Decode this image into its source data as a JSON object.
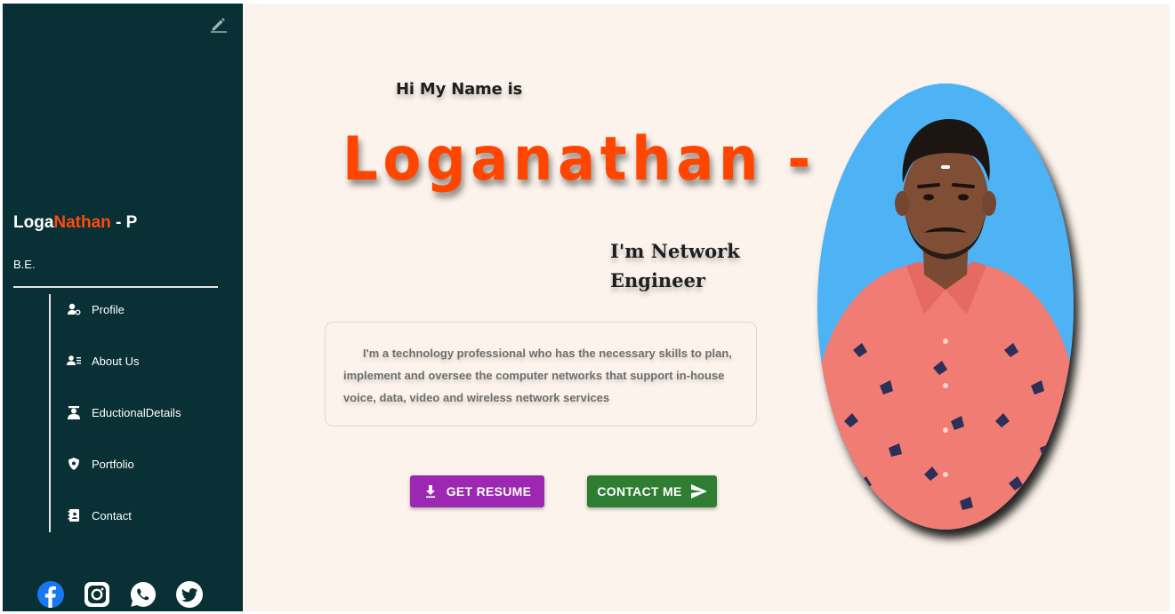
{
  "sidebar": {
    "brand_first": "Loga",
    "brand_accent": "Nathan",
    "brand_last": " - P",
    "degree": "B.E.",
    "nav": [
      {
        "label": "Profile",
        "icon": "user-cog-icon"
      },
      {
        "label": "About Us",
        "icon": "contact-list-icon"
      },
      {
        "label": "EductionalDetails",
        "icon": "graduate-icon"
      },
      {
        "label": "Portfolio",
        "icon": "shield-icon"
      },
      {
        "label": "Contact",
        "icon": "contact-book-icon"
      }
    ],
    "socials": [
      "facebook-icon",
      "instagram-icon",
      "whatsapp-icon",
      "twitter-icon"
    ],
    "edit_icon": "pencil-icon"
  },
  "hero": {
    "greeting": "Hi My Name is",
    "name": "Loganathan -",
    "role_line1": "I'm Network",
    "role_line2": "Engineer",
    "about": "I'm a technology professional who has the necessary skills to plan, implement and oversee the computer networks that support in-house voice, data, video and wireless network services"
  },
  "buttons": {
    "resume_label": "GET RESUME",
    "contact_label": "CONTACT ME"
  },
  "colors": {
    "sidebar_bg": "#093035",
    "main_bg": "#fcf4ec",
    "accent": "#ff4500",
    "resume_btn": "#9c27b0",
    "contact_btn": "#2e7d32",
    "photo_bg": "#4db3f5"
  }
}
